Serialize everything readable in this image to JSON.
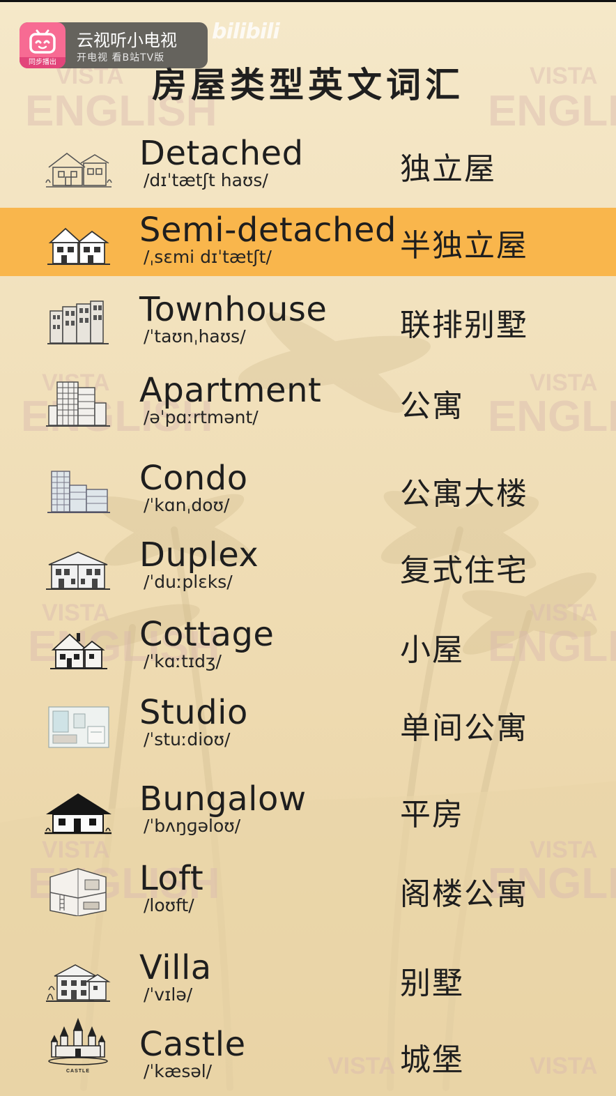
{
  "app_badge": {
    "title": "云视听小电视",
    "subtitle": "开电视 看B站TV版",
    "logo_caption": "同步播出",
    "logo_color": "#f76b93"
  },
  "watermark": "bilibili",
  "page_title": "房屋类型英文词汇",
  "highlight_color": "#f9b64c",
  "background_color": "#f3e4c2",
  "vocabulary": [
    {
      "word": "Detached",
      "phonetic": "/dɪˈtætʃt haʊs/",
      "chinese": "独立屋",
      "icon": "detached-house-icon",
      "highlighted": false
    },
    {
      "word": "Semi-detached",
      "phonetic": "/ˌsɛmi dɪˈtætʃt/",
      "chinese": "半独立屋",
      "icon": "semi-detached-house-icon",
      "highlighted": true
    },
    {
      "word": "Townhouse",
      "phonetic": "/ˈtaʊnˌhaʊs/",
      "chinese": "联排别墅",
      "icon": "townhouse-icon",
      "highlighted": false
    },
    {
      "word": "Apartment",
      "phonetic": "/əˈpɑːrtmənt/",
      "chinese": "公寓",
      "icon": "apartment-icon",
      "highlighted": false
    },
    {
      "word": "Condo",
      "phonetic": "/ˈkɑnˌdoʊ/",
      "chinese": "公寓大楼",
      "icon": "condo-icon",
      "highlighted": false
    },
    {
      "word": "Duplex",
      "phonetic": "/ˈduːplɛks/",
      "chinese": "复式住宅",
      "icon": "duplex-icon",
      "highlighted": false
    },
    {
      "word": "Cottage",
      "phonetic": "/ˈkɑːtɪdʒ/",
      "chinese": "小屋",
      "icon": "cottage-icon",
      "highlighted": false
    },
    {
      "word": "Studio",
      "phonetic": "/ˈstuːdioʊ/",
      "chinese": "单间公寓",
      "icon": "studio-icon",
      "highlighted": false
    },
    {
      "word": "Bungalow",
      "phonetic": "/ˈbʌŋɡəloʊ/",
      "chinese": "平房",
      "icon": "bungalow-icon",
      "highlighted": false
    },
    {
      "word": "Loft",
      "phonetic": "/loʊft/",
      "chinese": "阁楼公寓",
      "icon": "loft-icon",
      "highlighted": false
    },
    {
      "word": "Villa",
      "phonetic": "/ˈvɪlə/",
      "chinese": "别墅",
      "icon": "villa-icon",
      "highlighted": false
    },
    {
      "word": "Castle",
      "phonetic": "/ˈkæsəl/",
      "chinese": "城堡",
      "icon": "castle-icon",
      "icon_caption": "CASTLE",
      "highlighted": false
    }
  ],
  "bg_watermark_lines": [
    "VISTA",
    "ENGLISH"
  ]
}
